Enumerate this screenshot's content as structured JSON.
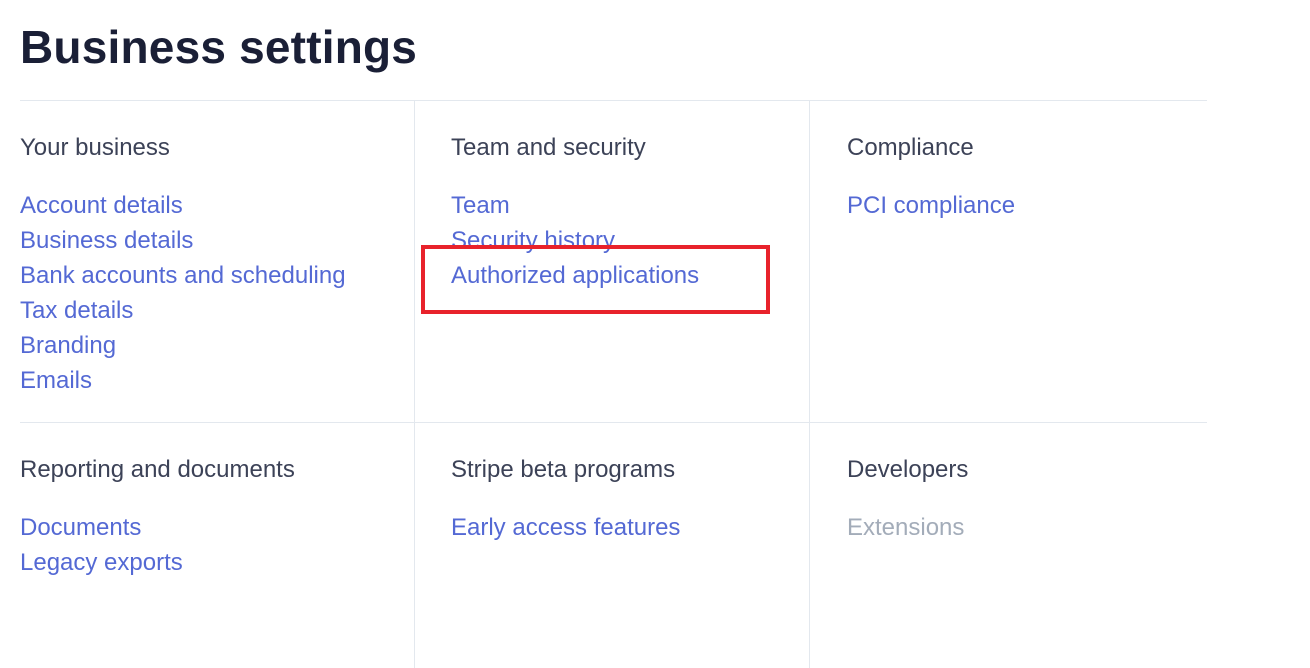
{
  "page": {
    "title": "Business settings"
  },
  "sections": [
    {
      "heading": "Your business",
      "links": [
        {
          "label": "Account details",
          "enabled": true
        },
        {
          "label": "Business details",
          "enabled": true
        },
        {
          "label": "Bank accounts and scheduling",
          "enabled": true
        },
        {
          "label": "Tax details",
          "enabled": true
        },
        {
          "label": "Branding",
          "enabled": true
        },
        {
          "label": "Emails",
          "enabled": true
        }
      ]
    },
    {
      "heading": "Team and security",
      "links": [
        {
          "label": "Team",
          "enabled": true
        },
        {
          "label": "Security history",
          "enabled": true
        },
        {
          "label": "Authorized applications",
          "enabled": true
        }
      ]
    },
    {
      "heading": "Compliance",
      "links": [
        {
          "label": "PCI compliance",
          "enabled": true
        }
      ]
    },
    {
      "heading": "Reporting and documents",
      "links": [
        {
          "label": "Documents",
          "enabled": true
        },
        {
          "label": "Legacy exports",
          "enabled": true
        }
      ]
    },
    {
      "heading": "Stripe beta programs",
      "links": [
        {
          "label": "Early access features",
          "enabled": true
        }
      ]
    },
    {
      "heading": "Developers",
      "links": [
        {
          "label": "Extensions",
          "enabled": false
        }
      ]
    }
  ],
  "colors": {
    "title": "#1a1f36",
    "heading": "#3c4257",
    "link": "#5469d4",
    "link_disabled": "#a3acb9",
    "divider": "#e3e8ee",
    "highlight": "#e8222b"
  }
}
